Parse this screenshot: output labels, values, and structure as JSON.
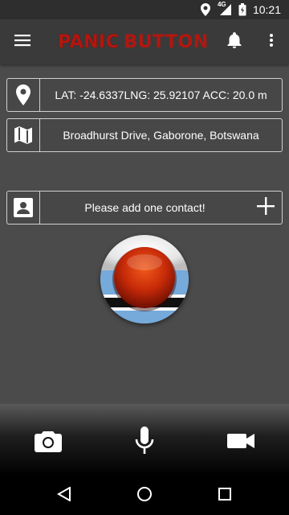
{
  "status_bar": {
    "time": "10:21",
    "network": "4G",
    "icons": [
      "location-icon",
      "signal-icon",
      "battery-icon"
    ]
  },
  "app_bar": {
    "logo_word1": "PANIC",
    "logo_word2": "BUTTON",
    "icons": [
      "menu-icon",
      "bell-icon",
      "more-vert-icon"
    ]
  },
  "location": {
    "coords": "LAT: -24.6337LNG: 25.92107  ACC: 20.0 m",
    "address": "Broadhurst Drive, Gaborone, Botswana",
    "icons": [
      "map-pin-icon",
      "map-icon"
    ]
  },
  "contact": {
    "prompt": "Please add one contact!",
    "icons": [
      "contact-card-icon",
      "add-icon"
    ]
  },
  "bottom_actions": {
    "icons": [
      "camera-icon",
      "microphone-icon",
      "video-camera-icon"
    ]
  },
  "nav": {
    "icons": [
      "back-icon",
      "home-icon",
      "recents-icon"
    ]
  },
  "colors": {
    "background": "#4b4b4b",
    "app_bar": "#3a3a3a",
    "logo_red": "#b3160f",
    "flag_blue": "#75aadb",
    "panic_red": "#c62a08"
  }
}
